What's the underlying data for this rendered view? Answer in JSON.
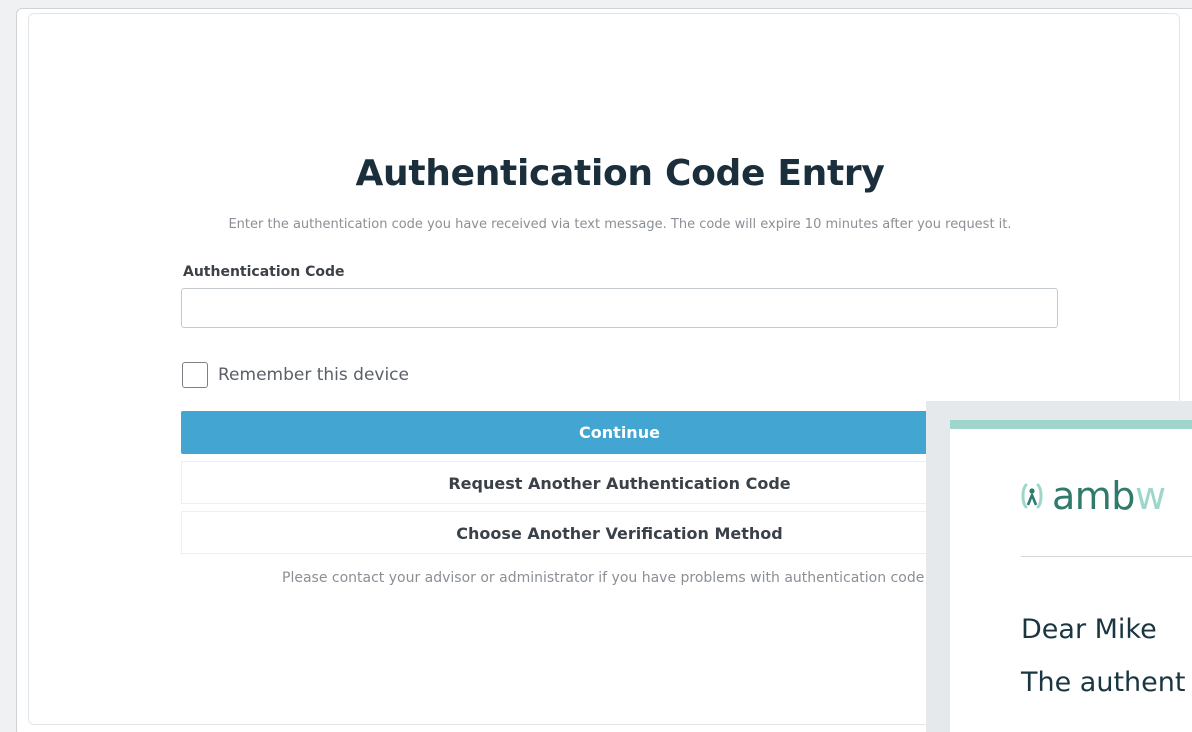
{
  "auth": {
    "title": "Authentication Code Entry",
    "subtitle": "Enter the authentication code you have received via text message. The code will expire 10 minutes after you request it.",
    "code_label": "Authentication Code",
    "code_value": "",
    "remember_label": "Remember this device",
    "remember_checked": false,
    "continue_label": "Continue",
    "request_label": "Request Another Authentication Code",
    "choose_label": "Choose Another Verification Method",
    "contact_text": "Please contact your advisor or administrator if you have problems with authentication code d"
  },
  "email": {
    "brand": "amb",
    "brand_faded": "w",
    "greeting": "Dear Mike",
    "body_line": "The authent"
  },
  "colors": {
    "primary_button": "#42a5d2",
    "brand_green": "#2f7a6a",
    "email_accent": "#9ed6cb",
    "title": "#1a2e3c"
  },
  "icons": {
    "brand_icon": "brand-logo-icon"
  }
}
